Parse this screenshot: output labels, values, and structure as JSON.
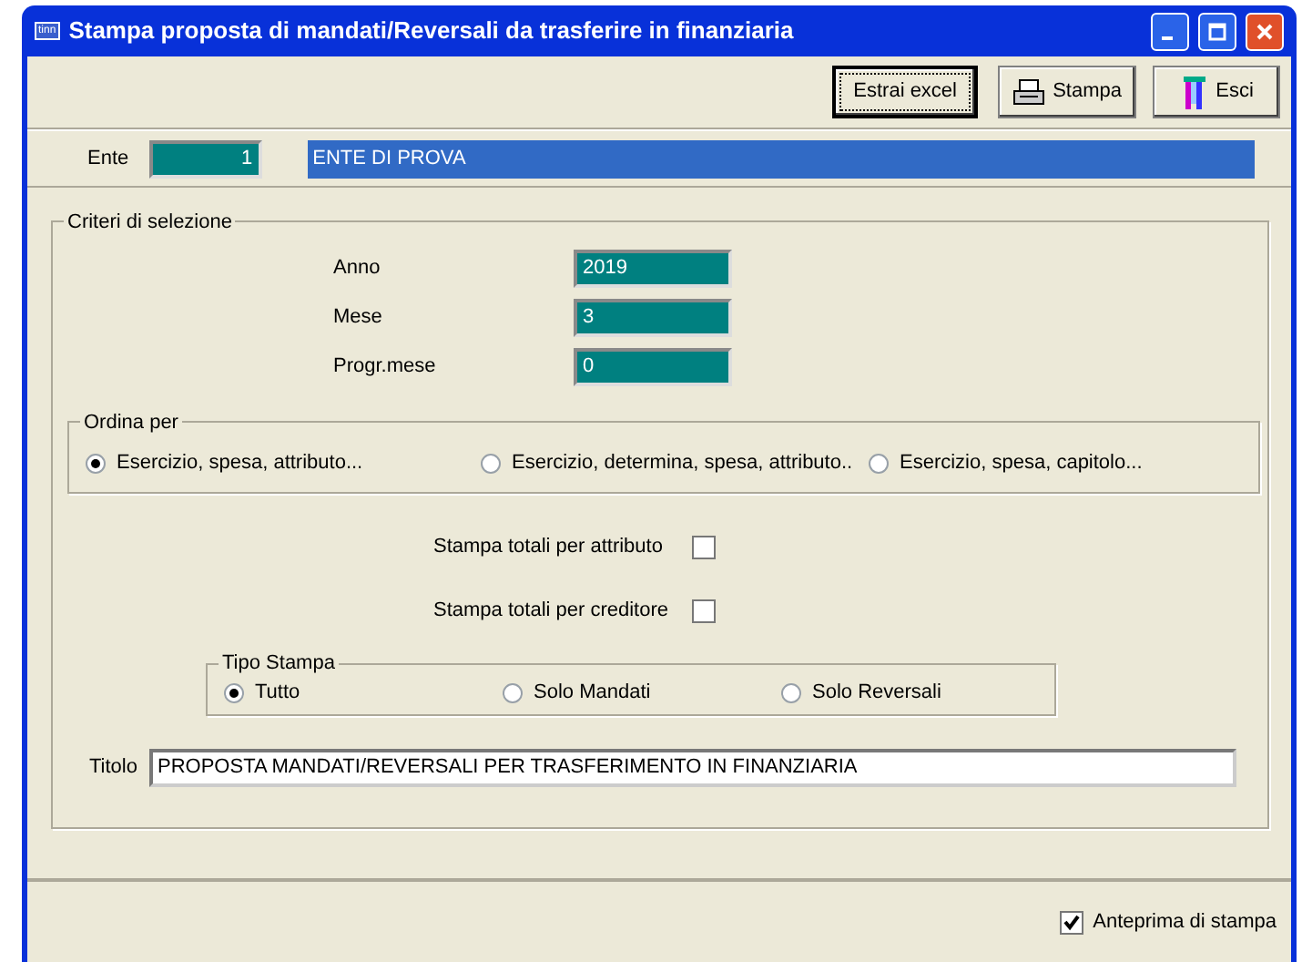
{
  "window": {
    "title": "Stampa proposta di mandati/Reversali da trasferire in finanziaria",
    "app_icon": "tinn"
  },
  "toolbar": [
    {
      "label": "Estrai excel",
      "kind": "text",
      "focused": true
    },
    {
      "label": "Stampa",
      "kind": "print",
      "focused": false
    },
    {
      "label": "Esci",
      "kind": "exit",
      "focused": false
    }
  ],
  "ente": {
    "label": "Ente",
    "code": "1",
    "name": "ENTE DI PROVA"
  },
  "criteri": {
    "title": "Criteri di selezione",
    "fields": [
      {
        "label": "Anno",
        "value": "2019"
      },
      {
        "label": "Mese",
        "value": "3"
      },
      {
        "label": "Progr.mese",
        "value": "0"
      }
    ],
    "ordina": {
      "title": "Ordina per",
      "options": [
        {
          "label": "Esercizio, spesa, attributo...",
          "selected": true
        },
        {
          "label": "Esercizio, determina, spesa, attributo..",
          "selected": false
        },
        {
          "label": "Esercizio, spesa, capitolo...",
          "selected": false
        }
      ]
    },
    "checks": [
      {
        "label": "Stampa totali per attributo",
        "checked": false
      },
      {
        "label": "Stampa totali per creditore",
        "checked": false
      }
    ],
    "tipo": {
      "title": "Tipo Stampa",
      "options": [
        {
          "label": "Tutto",
          "selected": true
        },
        {
          "label": "Solo Mandati",
          "selected": false
        },
        {
          "label": "Solo Reversali",
          "selected": false
        }
      ]
    },
    "titolo": {
      "label": "Titolo",
      "value": "PROPOSTA MANDATI/REVERSALI PER TRASFERIMENTO IN FINANZIARIA"
    }
  },
  "footer": {
    "label": "Anteprima di stampa",
    "checked": true
  }
}
